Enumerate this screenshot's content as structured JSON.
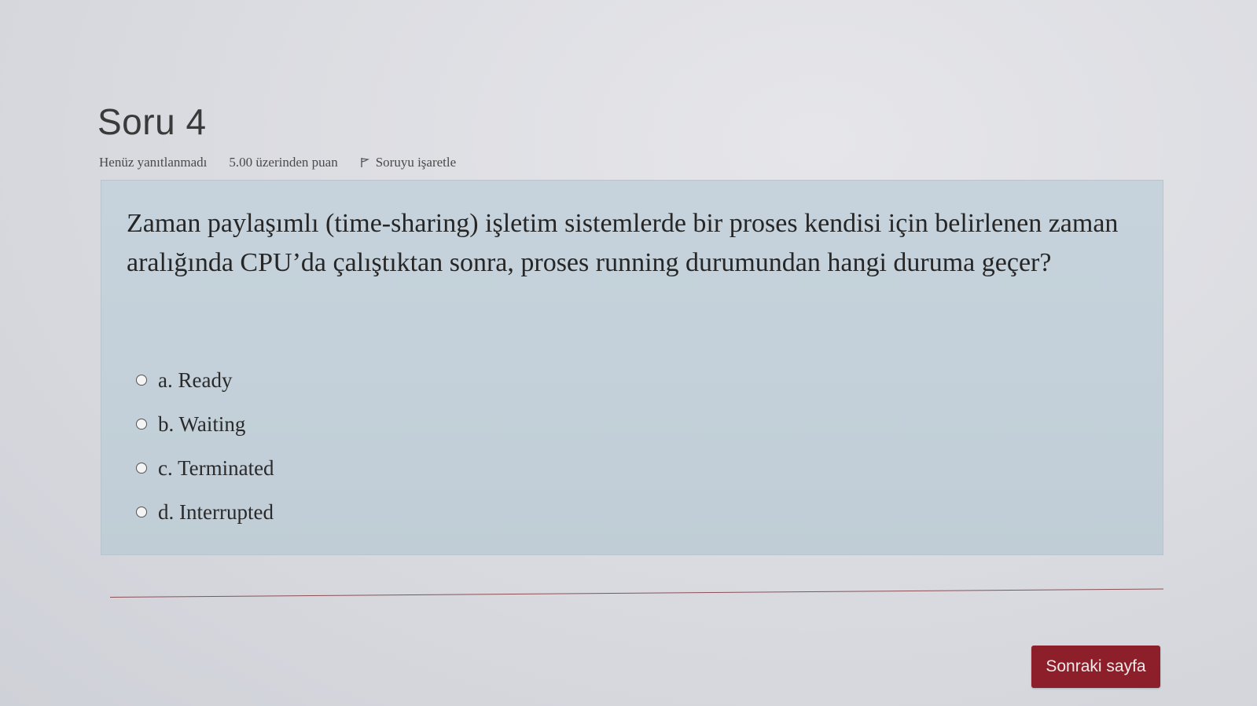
{
  "question": {
    "title": "Soru 4",
    "status": "Henüz yanıtlanmadı",
    "grade": "5.00 üzerinden puan",
    "flag_label": "Soruyu işaretle",
    "text": "Zaman paylaşımlı (time-sharing)  işletim sistemlerde bir proses kendisi için belirlenen zaman aralığında CPU’da çalıştıktan sonra, proses running durumundan hangi duruma geçer?",
    "answers": [
      {
        "label": "a. Ready",
        "selected": false
      },
      {
        "label": "b. Waiting",
        "selected": false
      },
      {
        "label": "c. Terminated",
        "selected": false
      },
      {
        "label": "d. Interrupted",
        "selected": false
      }
    ]
  },
  "navigation": {
    "next_label": "Sonraki sayfa"
  },
  "icons": {
    "flag": "flag-icon",
    "radio": "radio-button-icon"
  },
  "colors": {
    "question_box_bg": "#c5d2db",
    "next_button_bg": "#8c1f2a",
    "divider": "#8a5056"
  }
}
